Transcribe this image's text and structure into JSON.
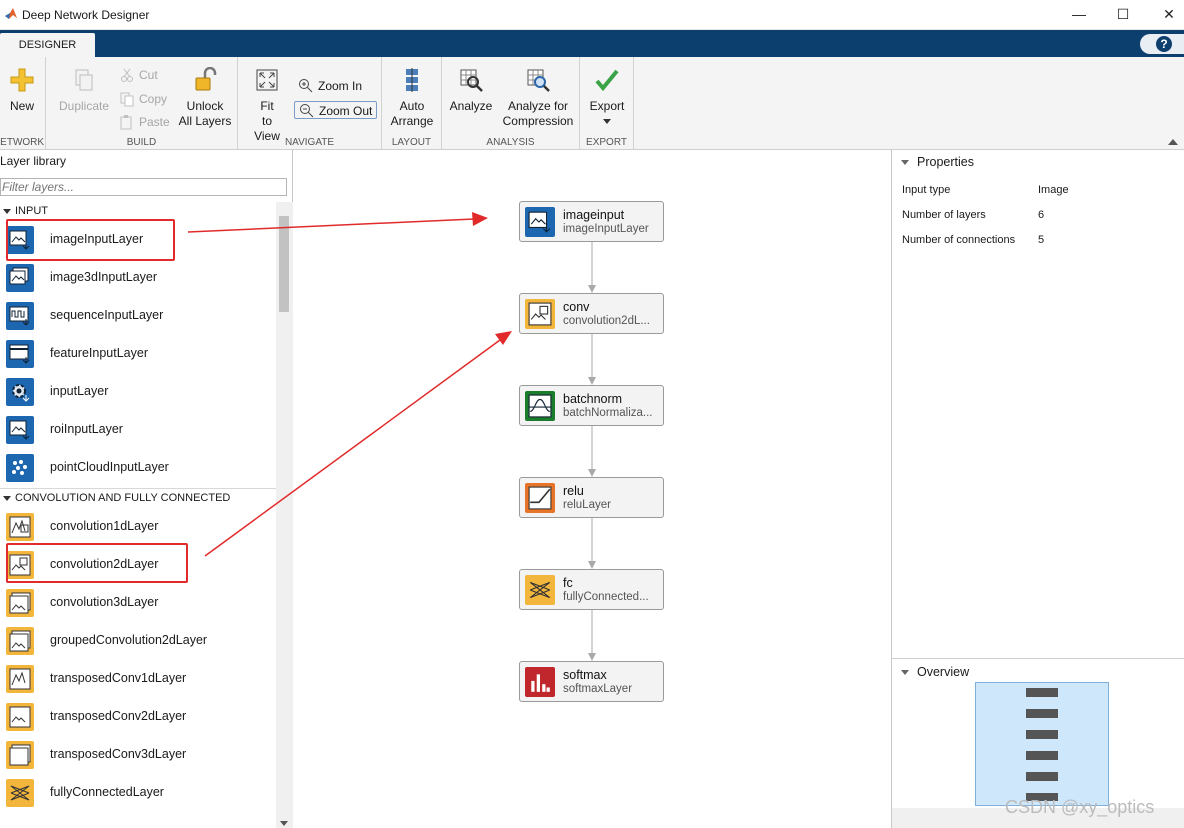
{
  "window": {
    "title": "Deep Network Designer",
    "minimize": "—",
    "maximize": "☐",
    "close": "✕"
  },
  "tabs": [
    {
      "label": "DESIGNER"
    }
  ],
  "help": "?",
  "toolstrip": {
    "network": {
      "label": "NETWORK",
      "new": "New"
    },
    "build": {
      "label": "BUILD",
      "duplicate": "Duplicate",
      "cut": "Cut",
      "copy": "Copy",
      "paste": "Paste",
      "unlock": "Unlock",
      "unlock2": "All Layers"
    },
    "navigate": {
      "label": "NAVIGATE",
      "fit": "Fit",
      "fit2": "to View",
      "zoom_in": "Zoom In",
      "zoom_out": "Zoom Out"
    },
    "layout": {
      "label": "LAYOUT",
      "auto": "Auto",
      "auto2": "Arrange"
    },
    "analysis": {
      "label": "ANALYSIS",
      "analyze": "Analyze",
      "analyze_comp": "Analyze for",
      "analyze_comp2": "Compression"
    },
    "export": {
      "label": "EXPORT",
      "export": "Export"
    }
  },
  "layer_library": {
    "title": "Layer library",
    "filter_placeholder": "Filter layers...",
    "categories": [
      {
        "name": "INPUT",
        "items": [
          "imageInputLayer",
          "image3dInputLayer",
          "sequenceInputLayer",
          "featureInputLayer",
          "inputLayer",
          "roiInputLayer",
          "pointCloudInputLayer"
        ]
      },
      {
        "name": "CONVOLUTION AND FULLY CONNECTED",
        "items": [
          "convolution1dLayer",
          "convolution2dLayer",
          "convolution3dLayer",
          "groupedConvolution2dLayer",
          "transposedConv1dLayer",
          "transposedConv2dLayer",
          "transposedConv3dLayer",
          "fullyConnectedLayer"
        ]
      }
    ]
  },
  "network": {
    "layers": [
      {
        "name": "imageinput",
        "type": "imageInputLayer",
        "color": "#1d67b1"
      },
      {
        "name": "conv",
        "type": "convolution2dL...",
        "color": "#f2b63c"
      },
      {
        "name": "batchnorm",
        "type": "batchNormaliza...",
        "color": "#1b7d2b"
      },
      {
        "name": "relu",
        "type": "reluLayer",
        "color": "#e8742a"
      },
      {
        "name": "fc",
        "type": "fullyConnected...",
        "color": "#f2b63c"
      },
      {
        "name": "softmax",
        "type": "softmaxLayer",
        "color": "#c0272d"
      }
    ]
  },
  "properties": {
    "title": "Properties",
    "rows": [
      {
        "key": "Input type",
        "value": "Image"
      },
      {
        "key": "Number of layers",
        "value": "6"
      },
      {
        "key": "Number of connections",
        "value": "5"
      }
    ]
  },
  "overview": {
    "title": "Overview"
  },
  "watermark": "CSDN @xy_optics",
  "colors": {
    "tab_strip": "#0d3f6e",
    "annotation": "#e12a2a"
  }
}
